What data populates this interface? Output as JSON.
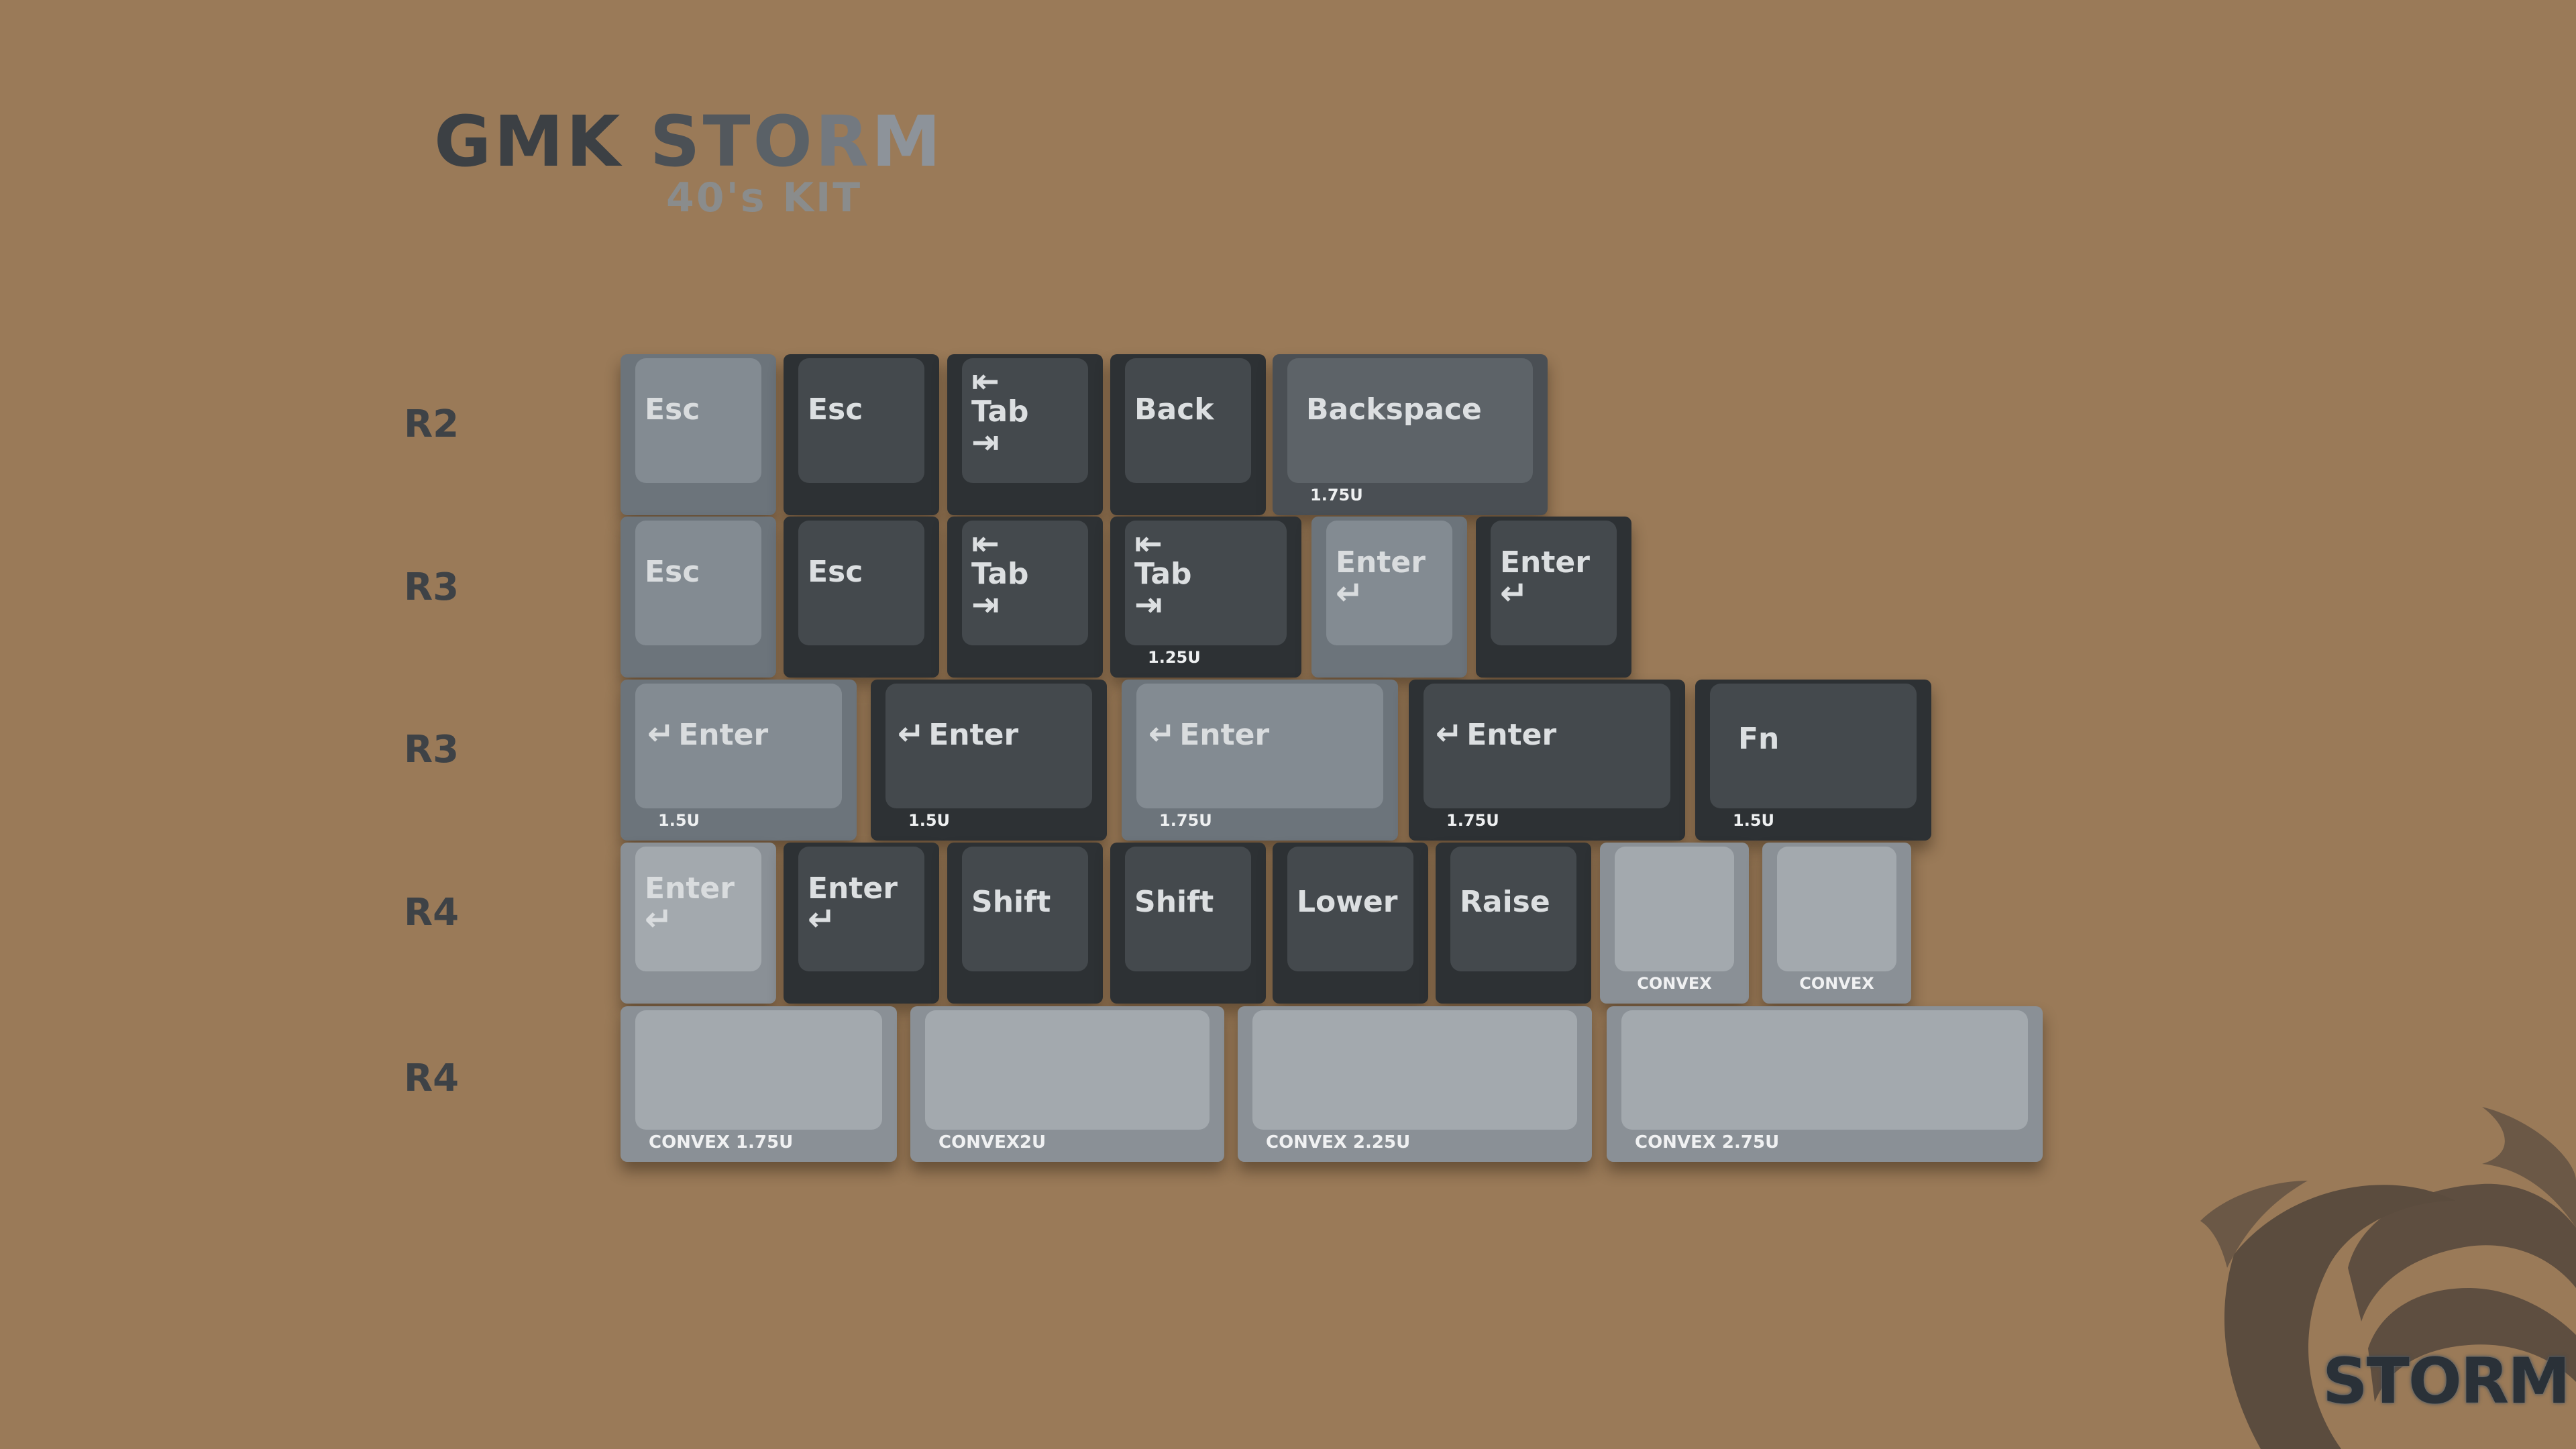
{
  "title": {
    "prefix": "GMK",
    "storm_letters": [
      "S",
      "T",
      "O",
      "R",
      "M"
    ],
    "subtitle": "40's KIT"
  },
  "brand": "STORM",
  "rows": [
    {
      "label": "R2",
      "keys": [
        {
          "legend": "Esc",
          "note": "",
          "color": "light"
        },
        {
          "legend": "Esc",
          "note": "",
          "color": "dark"
        },
        {
          "legend": "Tab",
          "note": "",
          "color": "dark",
          "tab": true
        },
        {
          "legend": "Back",
          "note": "",
          "color": "dark"
        },
        {
          "legend": "Backspace",
          "note": "1.75U",
          "color": "mid"
        }
      ]
    },
    {
      "label": "R3",
      "keys": [
        {
          "legend": "Esc",
          "note": "",
          "color": "light"
        },
        {
          "legend": "Esc",
          "note": "",
          "color": "dark"
        },
        {
          "legend": "Tab",
          "note": "",
          "color": "dark",
          "tab": true
        },
        {
          "legend": "Tab",
          "note": "1.25U",
          "color": "dark",
          "tab": true
        },
        {
          "legend": "Enter",
          "note": "",
          "color": "light",
          "enter": true
        },
        {
          "legend": "Enter",
          "note": "",
          "color": "dark",
          "enter": true
        }
      ]
    },
    {
      "label": "R3",
      "keys": [
        {
          "legend": "Enter",
          "note": "1.5U",
          "color": "light"
        },
        {
          "legend": "Enter",
          "note": "1.5U",
          "color": "dark"
        },
        {
          "legend": "Enter",
          "note": "1.75U",
          "color": "light"
        },
        {
          "legend": "Enter",
          "note": "1.75U",
          "color": "dark"
        },
        {
          "legend": "Fn",
          "note": "1.5U",
          "color": "dark"
        }
      ]
    },
    {
      "label": "R4",
      "keys": [
        {
          "legend": "Enter",
          "note": "",
          "color": "pale",
          "enter": true
        },
        {
          "legend": "Enter",
          "note": "",
          "color": "dark",
          "enter": true
        },
        {
          "legend": "Shift",
          "note": "",
          "color": "dark"
        },
        {
          "legend": "Shift",
          "note": "",
          "color": "dark"
        },
        {
          "legend": "Lower",
          "note": "",
          "color": "dark"
        },
        {
          "legend": "Raise",
          "note": "",
          "color": "dark"
        },
        {
          "legend": "",
          "note": "CONVEX",
          "color": "pale"
        },
        {
          "legend": "",
          "note": "CONVEX",
          "color": "pale"
        }
      ]
    },
    {
      "label": "R4",
      "keys": [
        {
          "legend": "",
          "note": "CONVEX 1.75U",
          "color": "pale"
        },
        {
          "legend": "",
          "note": "CONVEX2U",
          "color": "pale"
        },
        {
          "legend": "",
          "note": "CONVEX 2.25U",
          "color": "pale"
        },
        {
          "legend": "",
          "note": "CONVEX 2.75U",
          "color": "pale"
        }
      ]
    }
  ],
  "colors": {
    "background": "#9a7a58",
    "dark_key": "#2d3134",
    "light_key": "#6c747b",
    "pale_key": "#8a9096"
  }
}
